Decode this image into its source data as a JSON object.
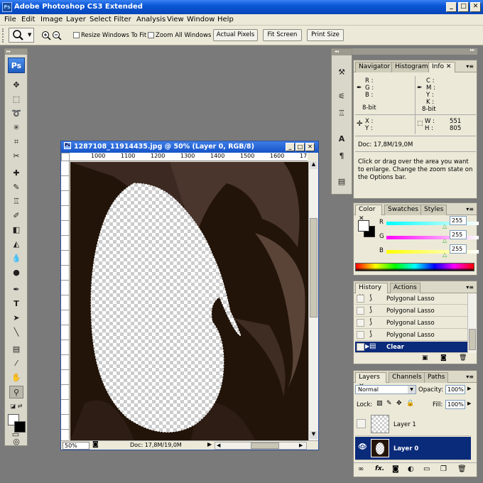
{
  "app": {
    "title": "Adobe Photoshop CS3 Extended",
    "icon_label": "Ps",
    "min": "_",
    "max": "□",
    "close": "✕"
  },
  "menu": [
    "File",
    "Edit",
    "Image",
    "Layer",
    "Select",
    "Filter",
    "Analysis",
    "View",
    "Window",
    "Help"
  ],
  "options": {
    "resize_windows": "Resize Windows To Fit",
    "zoom_all": "Zoom All Windows",
    "actual_pixels": "Actual Pixels",
    "fit_screen": "Fit Screen",
    "print_size": "Print Size"
  },
  "toolbox": {
    "logo": "Ps"
  },
  "document": {
    "title": "1287108_11914435.jpg @ 50% (Layer 0, RGB/8)",
    "ruler": [
      "1000",
      "1100",
      "1200",
      "1300",
      "1400",
      "1500",
      "1600",
      "17"
    ],
    "zoom": "50%",
    "doc_info": "Doc: 17,8M/19,0M",
    "arrow": "▶"
  },
  "info_panel": {
    "tabs": [
      "Navigator",
      "Histogram",
      "Info"
    ],
    "rgb_labels": [
      "R :",
      "G :",
      "B :"
    ],
    "cmyk_labels": [
      "C :",
      "M :",
      "Y :",
      "K :"
    ],
    "bits1": "8-bit",
    "bits2": "8-bit",
    "xy_labels": [
      "X :",
      "Y :"
    ],
    "wh_labels": [
      "W :",
      "H :"
    ],
    "w": "551",
    "h": "805",
    "doc": "Doc: 17,8M/19,0M",
    "help": "Click or drag over the area you want to enlarge. Change the zoom state on the Options bar."
  },
  "color_panel": {
    "tabs": [
      "Color",
      "Swatches",
      "Styles"
    ],
    "channels": [
      {
        "label": "R",
        "value": "255"
      },
      {
        "label": "G",
        "value": "255"
      },
      {
        "label": "B",
        "value": "255"
      }
    ]
  },
  "history_panel": {
    "tabs": [
      "History",
      "Actions"
    ],
    "items": [
      "Polygonal Lasso",
      "Polygonal Lasso",
      "Polygonal Lasso",
      "Polygonal Lasso",
      "Clear"
    ]
  },
  "layers_panel": {
    "tabs": [
      "Layers",
      "Channels",
      "Paths"
    ],
    "blend": "Normal",
    "opacity_label": "Opacity:",
    "opacity": "100%",
    "lock_label": "Lock:",
    "fill_label": "Fill:",
    "fill": "100%",
    "layers": [
      {
        "name": "Layer 1",
        "selected": false
      },
      {
        "name": "Layer 0",
        "selected": true
      }
    ],
    "footer_icons": [
      "link-icon",
      "fx-icon",
      "mask-icon",
      "adjustment-icon",
      "folder-icon",
      "new-layer-icon",
      "trash-icon"
    ]
  }
}
